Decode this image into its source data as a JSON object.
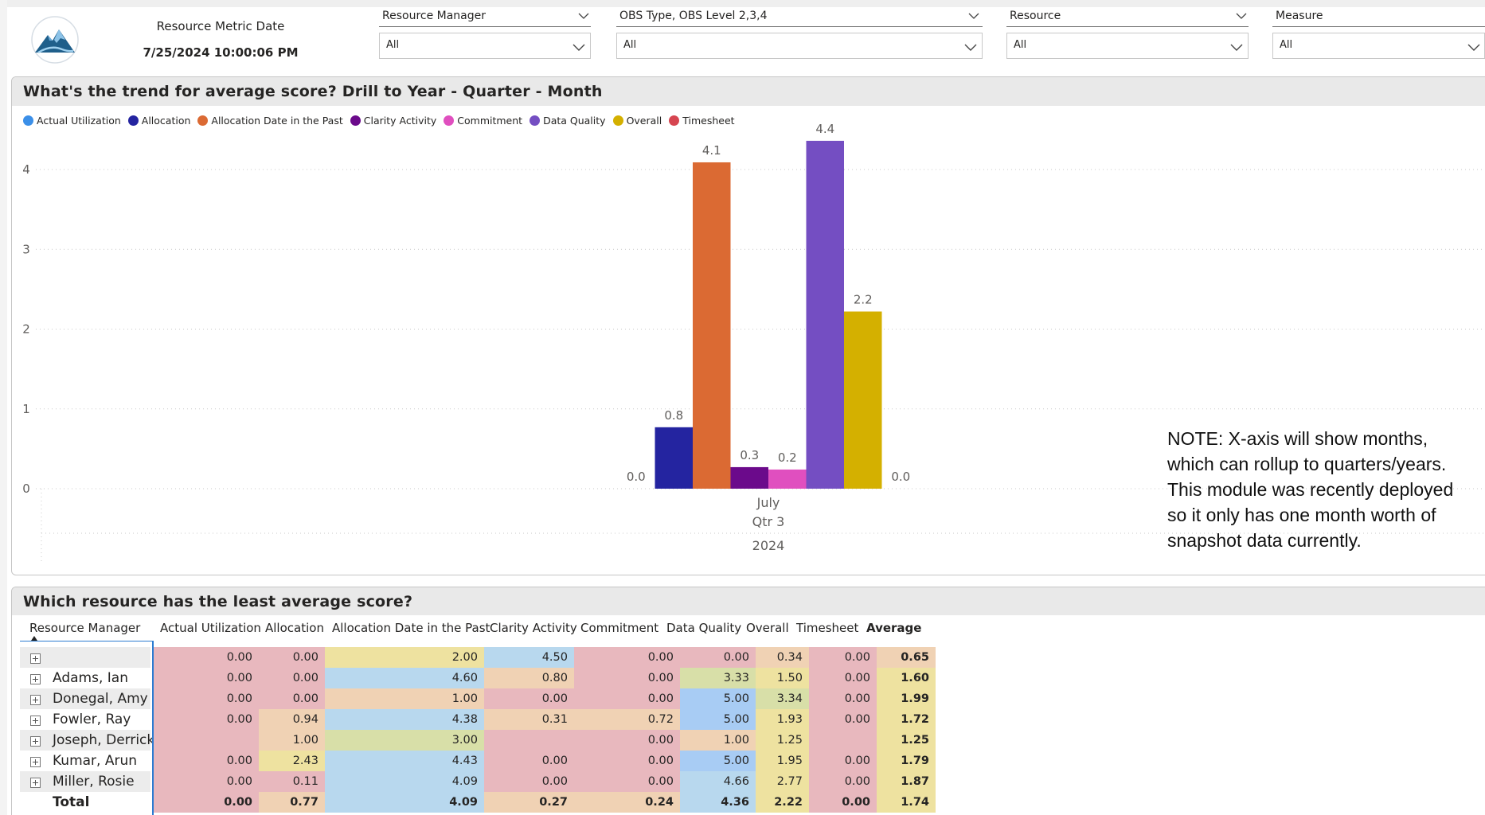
{
  "header": {
    "metric_date_label": "Resource Metric Date",
    "metric_date_value": "7/25/2024 10:00:06 PM"
  },
  "slicers": [
    {
      "title": "Resource Manager",
      "value": "All"
    },
    {
      "title": "OBS Type, OBS Level 2,3,4",
      "value": "All"
    },
    {
      "title": "Resource",
      "value": "All"
    },
    {
      "title": "Measure",
      "value": "All"
    }
  ],
  "chart_panel": {
    "title": "What's the trend for average score? Drill to Year - Quarter - Month",
    "note": "NOTE: X-axis will show months, which can rollup to quarters/years. This module was recently deployed so it only has one month worth of snapshot data currently."
  },
  "chart_data": {
    "type": "bar",
    "title": "What's the trend for average score? Drill to Year - Quarter - Month",
    "categories": [
      "July"
    ],
    "x_hierarchy": {
      "month": "July",
      "quarter": "Qtr 3",
      "year": "2024"
    },
    "yticks": [
      "0",
      "1",
      "2",
      "3",
      "4"
    ],
    "ylim": [
      0,
      4.6
    ],
    "grid": true,
    "legend_position": "top-left",
    "series": [
      {
        "name": "Actual Utilization",
        "color": "#3B8FE8",
        "values": [
          0.0
        ],
        "label": "0.0"
      },
      {
        "name": "Allocation",
        "color": "#2424A0",
        "values": [
          0.77
        ],
        "label": "0.8"
      },
      {
        "name": "Allocation Date in the Past",
        "color": "#DB6A33",
        "values": [
          4.09
        ],
        "label": "4.1"
      },
      {
        "name": "Clarity Activity",
        "color": "#6B0A8B",
        "values": [
          0.27
        ],
        "label": "0.3"
      },
      {
        "name": "Commitment",
        "color": "#E04FBF",
        "values": [
          0.24
        ],
        "label": "0.2"
      },
      {
        "name": "Data Quality",
        "color": "#744EC2",
        "values": [
          4.36
        ],
        "label": "4.4"
      },
      {
        "name": "Overall",
        "color": "#D4B000",
        "values": [
          2.22
        ],
        "label": "2.2"
      },
      {
        "name": "Timesheet",
        "color": "#D64550",
        "values": [
          0.0
        ],
        "label": "0.0"
      }
    ]
  },
  "table_panel": {
    "title": "Which resource has the least average score?",
    "columns": [
      "Resource Manager",
      "Actual Utilization",
      "Allocation",
      "Allocation Date in the Past",
      "Clarity Activity",
      "Commitment",
      "Data Quality",
      "Overall",
      "Timesheet",
      "Average"
    ],
    "rows": [
      {
        "name": "",
        "cells": [
          "0.00",
          "0.00",
          "2.00",
          "4.50",
          "0.00",
          "0.00",
          "0.34",
          "0.00",
          "0.65"
        ]
      },
      {
        "name": "Adams, Ian",
        "cells": [
          "0.00",
          "0.00",
          "4.60",
          "0.80",
          "0.00",
          "3.33",
          "1.50",
          "0.00",
          "1.60"
        ]
      },
      {
        "name": "Donegal, Amy",
        "cells": [
          "0.00",
          "0.00",
          "1.00",
          "0.00",
          "0.00",
          "5.00",
          "3.34",
          "0.00",
          "1.99"
        ]
      },
      {
        "name": "Fowler, Ray",
        "cells": [
          "0.00",
          "0.94",
          "4.38",
          "0.31",
          "0.72",
          "5.00",
          "1.93",
          "0.00",
          "1.72"
        ]
      },
      {
        "name": "Joseph, Derrick",
        "cells": [
          "",
          "1.00",
          "3.00",
          "",
          "0.00",
          "1.00",
          "1.25",
          "",
          "1.25"
        ]
      },
      {
        "name": "Kumar, Arun",
        "cells": [
          "0.00",
          "2.43",
          "4.43",
          "0.00",
          "0.00",
          "5.00",
          "1.95",
          "0.00",
          "1.79"
        ]
      },
      {
        "name": "Miller, Rosie",
        "cells": [
          "0.00",
          "0.11",
          "4.09",
          "0.00",
          "0.00",
          "4.66",
          "2.77",
          "0.00",
          "1.87"
        ]
      }
    ],
    "total": {
      "name": "Total",
      "cells": [
        "0.00",
        "0.77",
        "4.09",
        "0.27",
        "0.24",
        "4.36",
        "2.22",
        "0.00",
        "1.74"
      ]
    },
    "heat_colors": {
      "low": "#E8B8BE",
      "mid_low": "#F0D2B4",
      "mid": "#EEE2A0",
      "mid_high": "#D8DFA8",
      "high": "#B8D8EE",
      "top": "#A8CCF4"
    }
  }
}
